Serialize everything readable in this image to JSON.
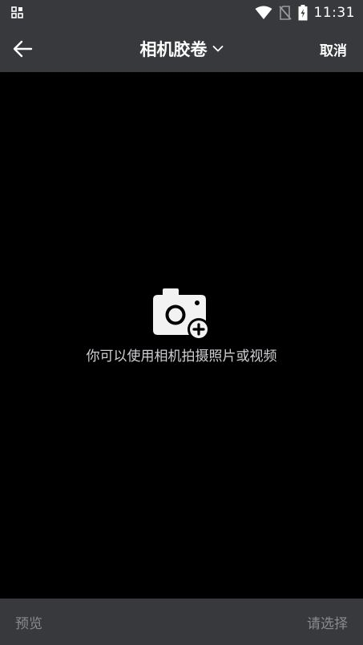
{
  "status_bar": {
    "time": "11:31",
    "icons": [
      "notification-grid-icon",
      "wifi-icon",
      "no-sim-icon",
      "battery-charging-icon"
    ]
  },
  "header": {
    "back_icon": "arrow-left-icon",
    "title": "相机胶卷",
    "title_dropdown_icon": "chevron-down-icon",
    "cancel_label": "取消"
  },
  "empty_state": {
    "icon": "camera-add-icon",
    "message": "你可以使用相机拍摄照片或视频"
  },
  "footer": {
    "preview_label": "预览",
    "select_label": "请选择"
  },
  "colors": {
    "bar_background": "#38393d",
    "content_background": "#000000",
    "primary_text": "#ffffff",
    "muted_text": "#8a8b8f",
    "empty_text": "#cfd0d3"
  }
}
